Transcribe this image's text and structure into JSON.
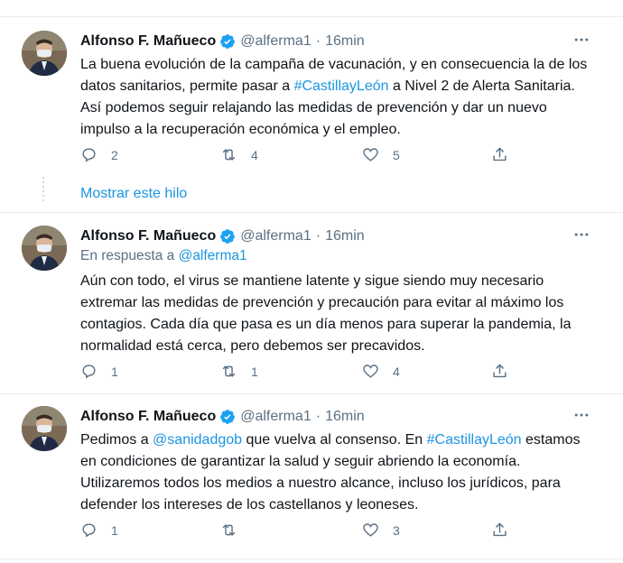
{
  "show_thread_label": "Mostrar este hilo",
  "tweets": [
    {
      "author_name": "Alfonso F. Mañueco",
      "handle": "@alferma1",
      "separator": "·",
      "time": "16min",
      "text_parts": [
        "La buena evolución de la campaña de vacunación, y en consecuencia la de los datos sanitarios, permite pasar a ",
        "#CastillayLeón",
        " a Nivel 2 de Alerta Sanitaria. Así podemos seguir relajando las medidas de prevención y dar un nuevo impulso a la recuperación económica y el empleo."
      ],
      "replies": "2",
      "retweets": "4",
      "likes": "5"
    },
    {
      "author_name": "Alfonso F. Mañueco",
      "handle": "@alferma1",
      "separator": "·",
      "time": "16min",
      "reply_prefix": "En respuesta a ",
      "reply_handle": "@alferma1",
      "text": "Aún con todo, el virus se mantiene latente y sigue siendo muy necesario extremar las medidas de prevención y precaución para evitar al máximo los contagios. Cada día que pasa es un día menos para superar la pandemia, la normalidad está cerca, pero debemos ser precavidos.",
      "replies": "1",
      "retweets": "1",
      "likes": "4"
    },
    {
      "author_name": "Alfonso F. Mañueco",
      "handle": "@alferma1",
      "separator": "·",
      "time": "16min",
      "text_parts": [
        "Pedimos a ",
        "@sanidadgob",
        " que vuelva al consenso. En ",
        "#CastillayLeón",
        " estamos en condiciones de garantizar la salud y seguir abriendo la economía. Utilizaremos todos los medios a nuestro alcance, incluso los jurídicos, para defender los intereses de los castellanos y leoneses."
      ],
      "replies": "1",
      "retweets": "",
      "likes": "3"
    }
  ],
  "colors": {
    "link": "#1b95e0",
    "muted": "#5b7083",
    "verified": "#1da1f2",
    "border": "#e6ecf0"
  },
  "icons": {
    "more": "more-dots-icon",
    "reply": "reply-icon",
    "retweet": "retweet-icon",
    "like": "heart-icon",
    "share": "share-icon",
    "verified": "verified-badge-icon"
  }
}
